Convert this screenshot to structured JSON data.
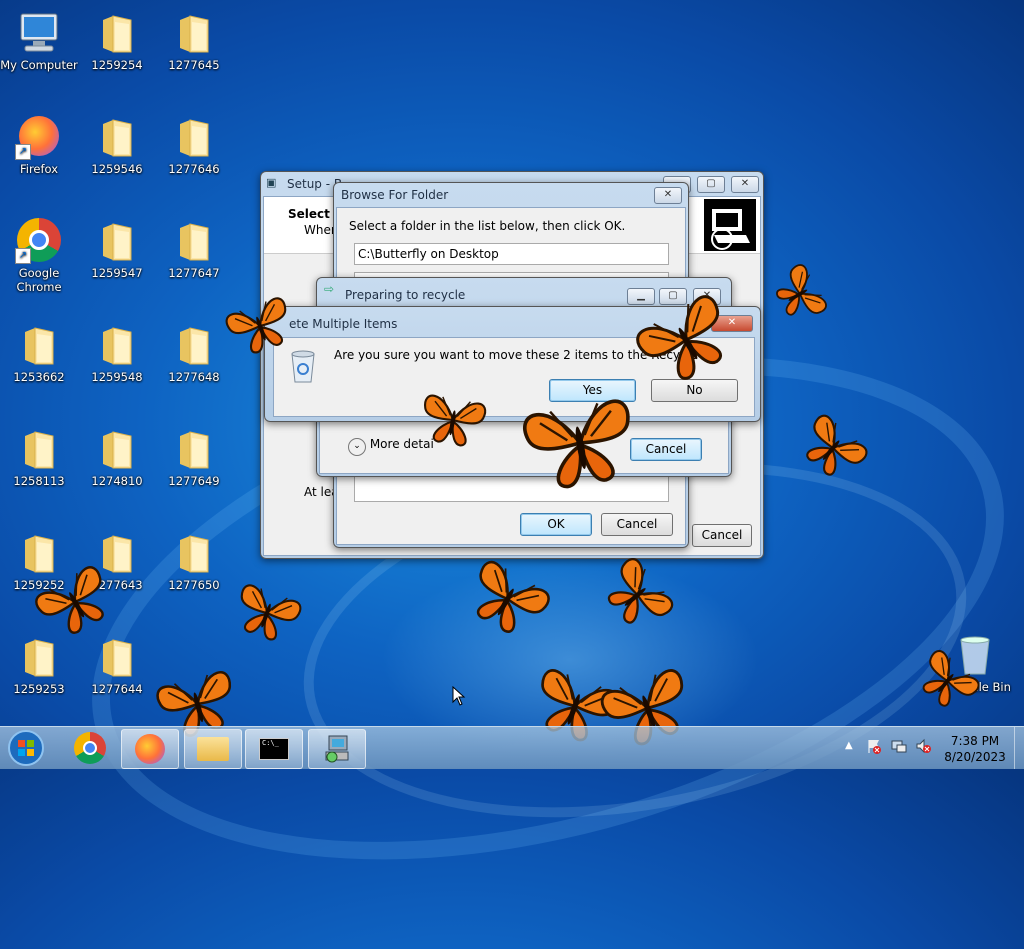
{
  "desktop": {
    "icons": [
      {
        "label": "My Computer",
        "kind": "computer"
      },
      {
        "label": "1259254",
        "kind": "folder"
      },
      {
        "label": "1277645",
        "kind": "folder"
      },
      {
        "label": "Firefox",
        "kind": "firefox"
      },
      {
        "label": "1259546",
        "kind": "folder"
      },
      {
        "label": "1277646",
        "kind": "folder"
      },
      {
        "label": "Google Chrome",
        "kind": "chrome"
      },
      {
        "label": "1259547",
        "kind": "folder"
      },
      {
        "label": "1277647",
        "kind": "folder"
      },
      {
        "label": "1253662",
        "kind": "folder"
      },
      {
        "label": "1259548",
        "kind": "folder"
      },
      {
        "label": "1277648",
        "kind": "folder"
      },
      {
        "label": "1258113",
        "kind": "folder"
      },
      {
        "label": "1274810",
        "kind": "folder"
      },
      {
        "label": "1277649",
        "kind": "folder"
      },
      {
        "label": "1259252",
        "kind": "folder"
      },
      {
        "label": "1277643",
        "kind": "folder"
      },
      {
        "label": "1277650",
        "kind": "folder"
      },
      {
        "label": "1259253",
        "kind": "folder"
      },
      {
        "label": "1277644",
        "kind": "folder"
      }
    ],
    "recycle_bin_label": "Recycle Bin",
    "recycle_bin_partial": "cycle Bin"
  },
  "setup_window": {
    "title": "Setup - Butterfly on Desktop",
    "title_visible": "Setup - B",
    "heading": "Select D",
    "subtext": "Where",
    "footer_text": "At leas",
    "cancel_label": "Cancel"
  },
  "browse_dialog": {
    "title": "Browse For Folder",
    "instruction": "Select a folder in the list below, then click OK.",
    "path_value": "C:\\Butterfly on Desktop",
    "ok_label": "OK",
    "cancel_label": "Cancel"
  },
  "recycle_progress": {
    "title": "Preparing to recycle",
    "more_details": "More detai",
    "cancel_label": "Cancel"
  },
  "delete_dialog": {
    "title": "ete Multiple Items",
    "message": "Are you sure you want to move these 2 items to the Recycle",
    "yes_label": "Yes",
    "no_label": "No"
  },
  "taskbar": {
    "time": "7:38 PM",
    "date": "8/20/2023",
    "tray_icons": [
      "show-hidden-icons-arrow",
      "action-center-flag-icon",
      "network-icon",
      "volume-muted-icon"
    ],
    "items": [
      "start-orb",
      "chrome",
      "firefox",
      "explorer",
      "cmd",
      "setup"
    ]
  },
  "colors": {
    "accent": "#0e63c2",
    "butterfly": "#f07a12"
  }
}
